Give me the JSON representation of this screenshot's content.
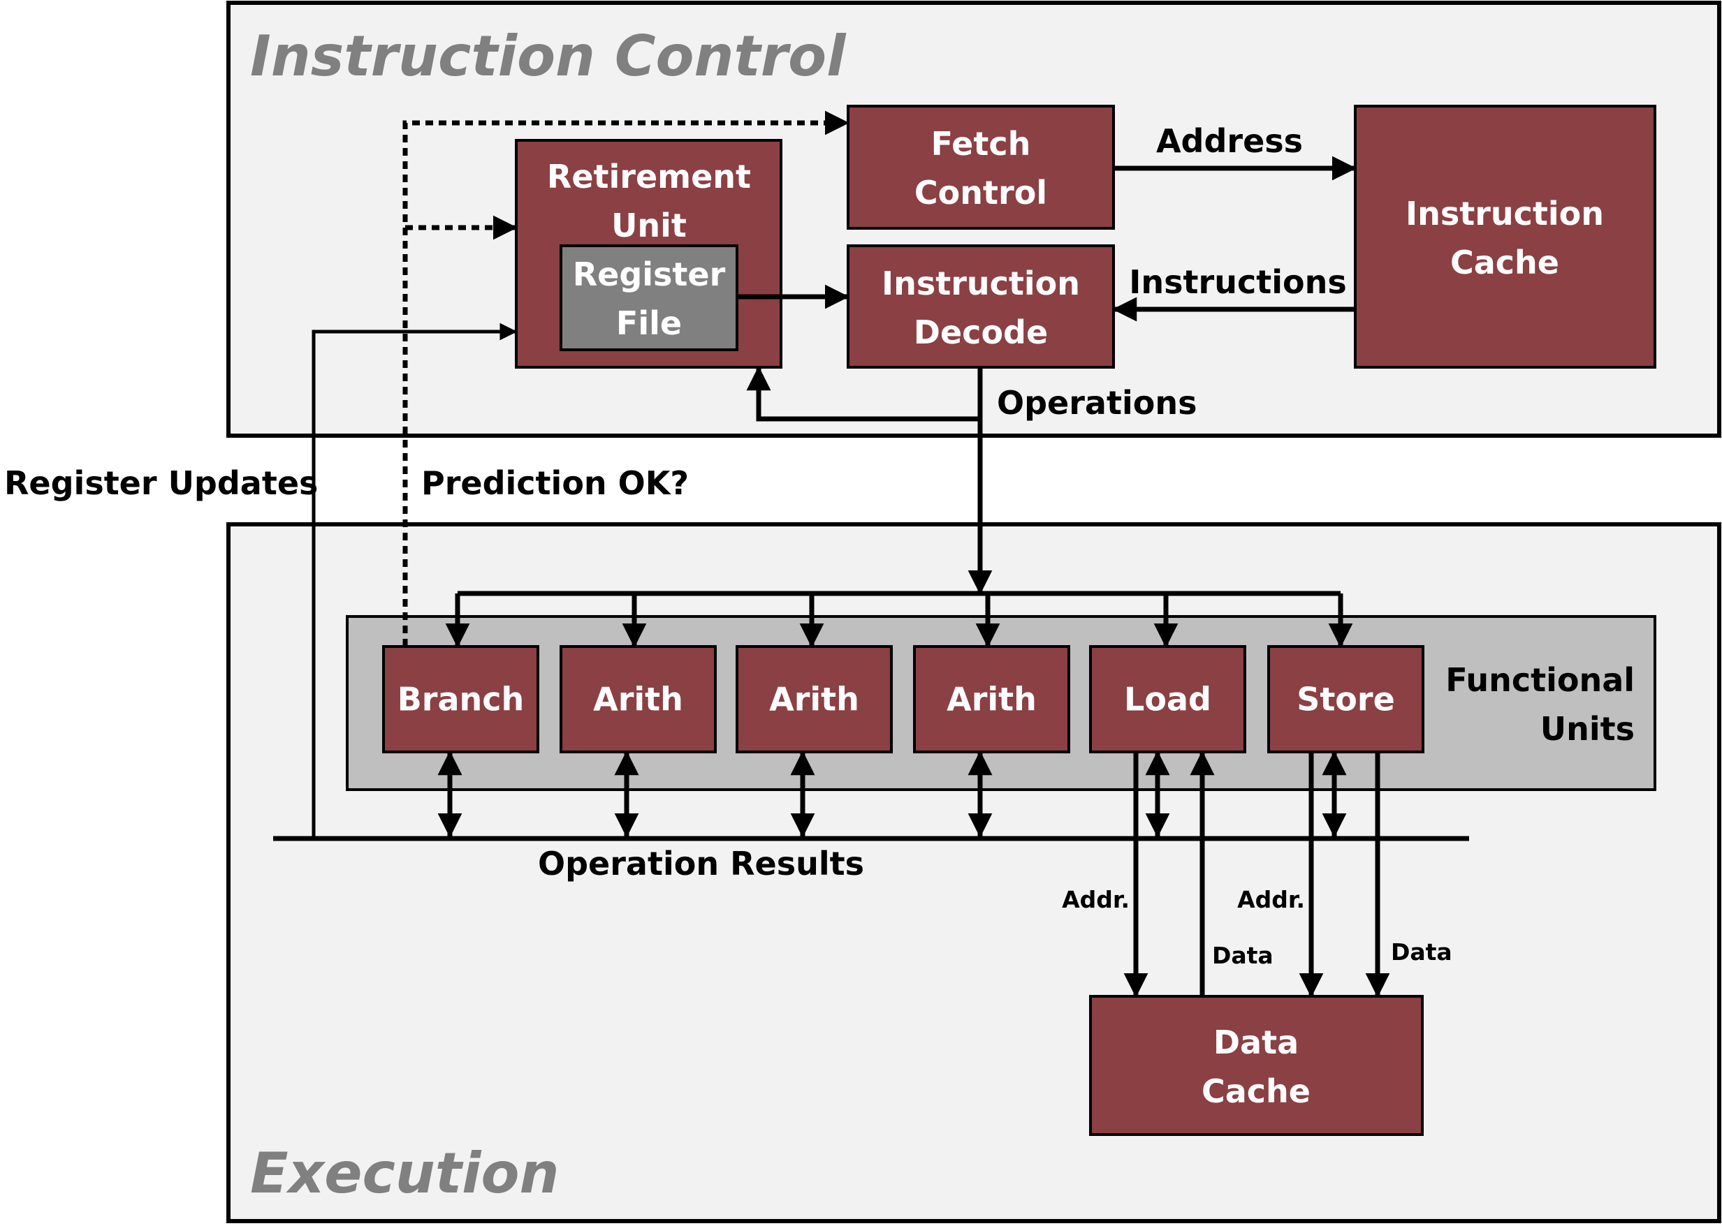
{
  "colors": {
    "unit_fill": "#8B4044",
    "register_file_fill": "#808080",
    "panel_fill": "#F2F2F2",
    "functional_units_fill": "#BFBFBF",
    "stroke": "#000000",
    "panel_title": "#808080"
  },
  "panels": {
    "instruction_control": {
      "title": "Instruction Control"
    },
    "execution": {
      "title": "Execution"
    }
  },
  "units": {
    "fetch_control": {
      "line1": "Fetch",
      "line2": "Control"
    },
    "instruction_decode": {
      "line1": "Instruction",
      "line2": "Decode"
    },
    "instruction_cache": {
      "line1": "Instruction",
      "line2": "Cache"
    },
    "retirement_unit": {
      "line1": "Retirement",
      "line2": "Unit"
    },
    "register_file": {
      "line1": "Register",
      "line2": "File"
    },
    "data_cache": {
      "line1": "Data",
      "line2": "Cache"
    }
  },
  "functional_units": {
    "label_line1": "Functional",
    "label_line2": "Units",
    "items": [
      {
        "label": "Branch"
      },
      {
        "label": "Arith"
      },
      {
        "label": "Arith"
      },
      {
        "label": "Arith"
      },
      {
        "label": "Load"
      },
      {
        "label": "Store"
      }
    ]
  },
  "signals": {
    "address": "Address",
    "instructions": "Instructions",
    "operations": "Operations",
    "register_updates": "Register Updates",
    "prediction_ok": "Prediction OK?",
    "operation_results": "Operation Results",
    "load_addr": "Addr.",
    "load_data": "Data",
    "store_addr": "Addr.",
    "store_data": "Data"
  }
}
